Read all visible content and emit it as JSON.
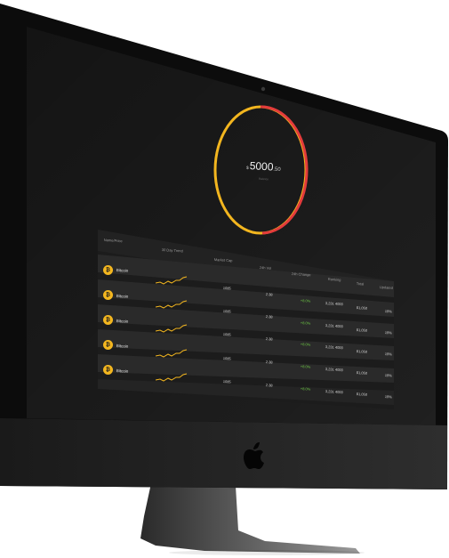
{
  "wallet": {
    "currency_symbol": "$",
    "balance_main": "5000",
    "balance_decimal": ".50",
    "sub_label": "Balance",
    "ring_colors": {
      "primary": "#f3b61f",
      "secondary": "#e33b3b"
    }
  },
  "table": {
    "headers": [
      "Name/Price",
      "30 Day Trend",
      "Market Cap",
      "24h Vol",
      "24h Change",
      "Ranking",
      "Total",
      "Updated"
    ],
    "rows": [
      {
        "name": "Bitcoin",
        "cap": "1085",
        "vol": "2.38",
        "change": "+8.0%",
        "rank": "3,231 4000",
        "total": "$1,050",
        "pct": "19%"
      },
      {
        "name": "Bitcoin",
        "cap": "1085",
        "vol": "2.38",
        "change": "+8.0%",
        "rank": "3,231 4000",
        "total": "$1,050",
        "pct": "19%"
      },
      {
        "name": "Bitcoin",
        "cap": "1085",
        "vol": "2.38",
        "change": "+8.0%",
        "rank": "3,231 4000",
        "total": "$1,050",
        "pct": "19%"
      },
      {
        "name": "Bitcoin",
        "cap": "1085",
        "vol": "2.38",
        "change": "+8.0%",
        "rank": "3,231 4000",
        "total": "$1,050",
        "pct": "19%"
      },
      {
        "name": "Bitcoin",
        "cap": "1085",
        "vol": "2.38",
        "change": "+8.0%",
        "rank": "3,231 4000",
        "total": "$1,050",
        "pct": "19%"
      }
    ]
  },
  "colors": {
    "accent": "#f3b61f",
    "positive": "#6cc644",
    "screen": "#141414"
  },
  "icons": {
    "coin": "bitcoin-icon",
    "brand": "apple-logo-icon",
    "camera": "camera-icon"
  }
}
